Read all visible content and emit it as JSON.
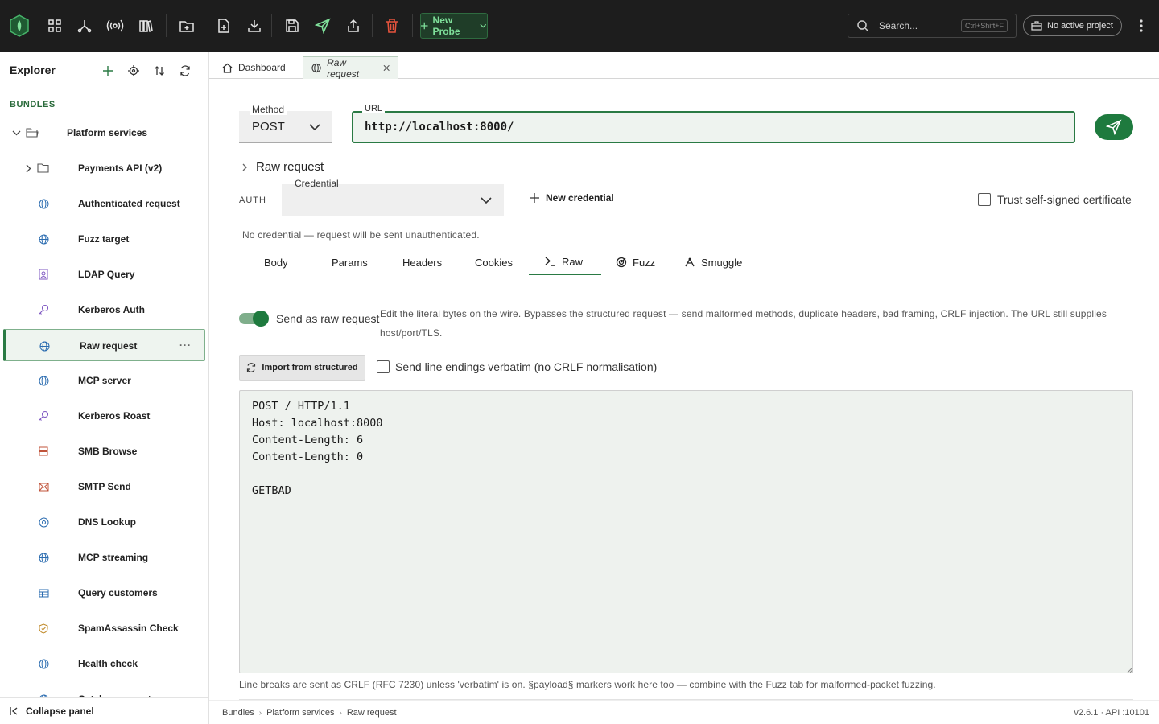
{
  "app": {
    "search_placeholder": "Search...",
    "search_shortcut": "Ctrl+Shift+F",
    "new_probe_label": "New Probe",
    "project_label": "No active project"
  },
  "sidebar": {
    "title": "Explorer",
    "section_label": "BUNDLES",
    "collapse_label": "Collapse panel",
    "items": [
      {
        "label": "Platform services",
        "icon": "folder-open-icon",
        "icon_color": "#555555"
      },
      {
        "label": "Payments API (v2)",
        "icon": "folder-icon",
        "icon_color": "#555555"
      },
      {
        "label": "Authenticated request",
        "icon": "globe-icon",
        "icon_color": "#2b6cb0"
      },
      {
        "label": "Fuzz target",
        "icon": "globe-icon",
        "icon_color": "#2b6cb0"
      },
      {
        "label": "LDAP Query",
        "icon": "address-book-icon",
        "icon_color": "#7e57c2"
      },
      {
        "label": "Kerberos Auth",
        "icon": "key-icon",
        "icon_color": "#7e57c2"
      },
      {
        "label": "Raw request",
        "icon": "globe-icon",
        "icon_color": "#2b6cb0"
      },
      {
        "label": "MCP server",
        "icon": "globe-icon",
        "icon_color": "#2b6cb0"
      },
      {
        "label": "Kerberos Roast",
        "icon": "key-icon",
        "icon_color": "#7e57c2"
      },
      {
        "label": "SMB Browse",
        "icon": "server-icon",
        "icon_color": "#c0533a"
      },
      {
        "label": "SMTP Send",
        "icon": "mail-icon",
        "icon_color": "#c0533a"
      },
      {
        "label": "DNS Lookup",
        "icon": "target-icon",
        "icon_color": "#2b6cb0"
      },
      {
        "label": "MCP streaming",
        "icon": "globe-icon",
        "icon_color": "#2b6cb0"
      },
      {
        "label": "Query customers",
        "icon": "table-icon",
        "icon_color": "#2b6cb0"
      },
      {
        "label": "SpamAssassin Check",
        "icon": "shield-icon",
        "icon_color": "#c08a2a"
      },
      {
        "label": "Health check",
        "icon": "globe-icon",
        "icon_color": "#2b6cb0"
      },
      {
        "label": "Catalog request",
        "icon": "globe-icon",
        "icon_color": "#2b6cb0"
      }
    ]
  },
  "tabs": [
    {
      "label": "Dashboard",
      "icon": "home-icon"
    },
    {
      "label": "Raw request",
      "icon": "globe-icon"
    }
  ],
  "request": {
    "method_label": "Method",
    "method": "POST",
    "url_label": "URL",
    "url": "http://localhost:8000/",
    "section_title": "Raw request",
    "auth_label": "AUTH",
    "credential_label": "Credential",
    "credential_value": "",
    "new_credential": "New credential",
    "trust_label": "Trust self-signed certificate",
    "no_credential_msg": "No credential — request will be sent unauthenticated."
  },
  "subtabs": [
    {
      "label": "Body"
    },
    {
      "label": "Params"
    },
    {
      "label": "Headers"
    },
    {
      "label": "Cookies"
    },
    {
      "label": "Raw",
      "active": true
    },
    {
      "label": "Fuzz"
    },
    {
      "label": "Smuggle"
    }
  ],
  "raw": {
    "toggle_label": "Send as raw request",
    "toggle_on": true,
    "description": "Edit the literal bytes on the wire. Bypasses the structured request — send malformed methods, duplicate headers, bad framing, CRLF injection. The URL still supplies host/port/TLS.",
    "import_label": "Import from structured",
    "verbatim_label": "Send line endings verbatim (no CRLF normalisation)",
    "verbatim_checked": false,
    "content": "POST / HTTP/1.1\nHost: localhost:8000\nContent-Length: 6\nContent-Length: 0\n\nGETBAD",
    "hint": "Line breaks are sent as CRLF (RFC 7230) unless 'verbatim' is on. §payload§ markers work here too — combine with the Fuzz tab for malformed-packet fuzzing."
  },
  "status": {
    "crumbs": [
      "Bundles",
      "Platform services",
      "Raw request"
    ],
    "version": "v2.6.1 · API :10101"
  },
  "colors": {
    "accent": "#2a7a44",
    "topbar": "#1d1d1d",
    "delete": "#e5533d"
  }
}
